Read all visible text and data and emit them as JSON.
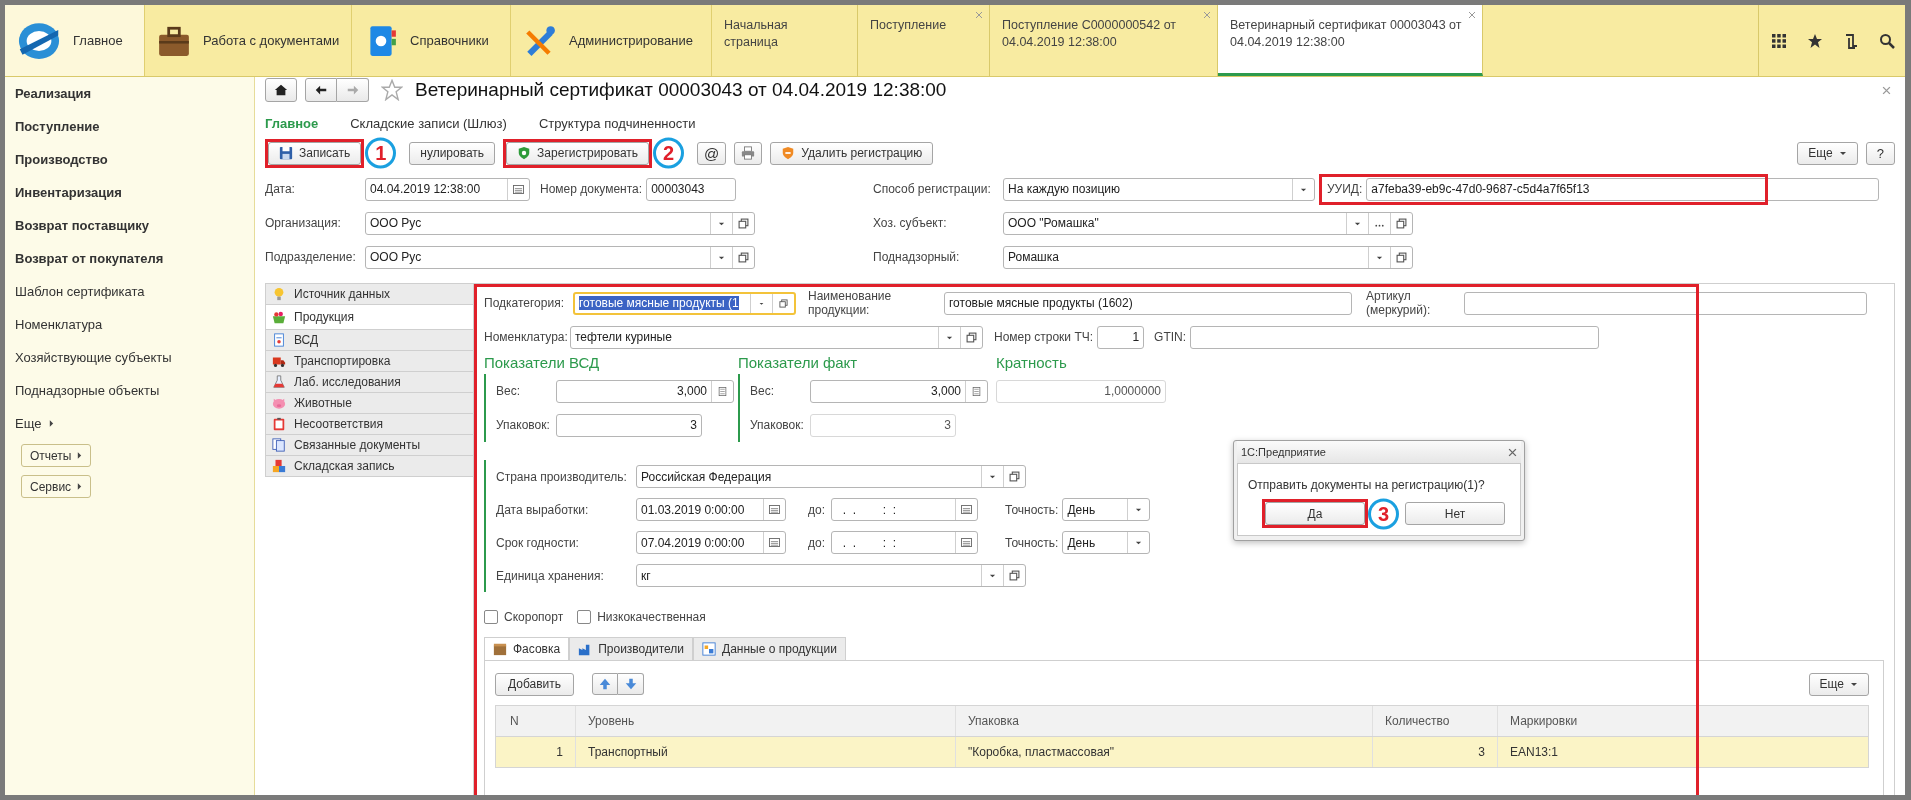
{
  "top_sections": [
    {
      "label": "Главное",
      "kind": "logo",
      "selected": true
    },
    {
      "label": "Работа с документами",
      "kind": "briefcase",
      "selected": false
    },
    {
      "label": "Справочники",
      "kind": "book",
      "selected": false
    },
    {
      "label": "Администрирование",
      "kind": "tools",
      "selected": false
    }
  ],
  "open_tabs": [
    {
      "label": "Начальная страница",
      "closable": false,
      "selected": false
    },
    {
      "label": "Поступление",
      "closable": true,
      "selected": false
    },
    {
      "label": "Поступление С0000000542 от 04.04.2019 12:38:00",
      "closable": true,
      "selected": false
    },
    {
      "label": "Ветеринарный сертификат 00003043 от 04.04.2019 12:38:00",
      "closable": true,
      "selected": true
    }
  ],
  "sidebar": {
    "items": [
      {
        "label": "Реализация",
        "kind": "section"
      },
      {
        "label": "Поступление",
        "kind": "section"
      },
      {
        "label": "Производство",
        "kind": "section"
      },
      {
        "label": "Инвентаризация",
        "kind": "section"
      },
      {
        "label": "Возврат поставщику",
        "kind": "section"
      },
      {
        "label": "Возврат от покупателя",
        "kind": "section"
      },
      {
        "label": "Шаблон сертификата",
        "kind": "link"
      },
      {
        "label": "Номенклатура",
        "kind": "link"
      },
      {
        "label": "Хозяйствующие субъекты",
        "kind": "link"
      },
      {
        "label": "Поднадзорные объекты",
        "kind": "link"
      },
      {
        "label": "Еще",
        "kind": "more"
      }
    ],
    "buttons": [
      "Отчеты",
      "Сервис"
    ]
  },
  "document": {
    "title": "Ветеринарный сертификат 00003043 от 04.04.2019 12:38:00",
    "favorite": false,
    "subtabs": [
      {
        "label": "Главное",
        "selected": true
      },
      {
        "label": "Складские записи (Шлюз)",
        "selected": false
      },
      {
        "label": "Структура подчиненности",
        "selected": false
      }
    ],
    "toolbar": [
      {
        "kind": "save",
        "label": "Записать",
        "highlighted": true,
        "callout": "1"
      },
      {
        "kind": "plain",
        "label": "нулировать",
        "highlighted": false
      },
      {
        "kind": "register",
        "label": "Зарегистрировать",
        "highlighted": true,
        "callout": "2"
      },
      {
        "kind": "glyph",
        "label": "@",
        "highlighted": false
      },
      {
        "kind": "print",
        "highlighted": false
      },
      {
        "kind": "unregister",
        "label": "Удалить регистрацию",
        "highlighted": false
      }
    ],
    "more_button": "Еще",
    "help_button": "?",
    "header": {
      "date": {
        "label": "Дата:",
        "value": "04.04.2019 12:38:00"
      },
      "doc_number": {
        "label": "Номер документа:",
        "value": "00003043"
      },
      "reg_method": {
        "label": "Способ регистрации:",
        "value": "На каждую позицию"
      },
      "uuid": {
        "label": "УУИД:",
        "value": "a7feba39-eb9c-47d0-9687-c5d4a7f65f13",
        "highlighted": true
      },
      "organization": {
        "label": "Организация:",
        "value": "ООО Рус"
      },
      "subject": {
        "label": "Хоз. субъект:",
        "value": "ООО \"Ромашка\""
      },
      "division": {
        "label": "Подразделение:",
        "value": "ООО Рус"
      },
      "supervised": {
        "label": "Поднадзорный:",
        "value": "Ромашка"
      }
    },
    "side_tabs": [
      {
        "label": "Источник данных",
        "kind": "bulb",
        "selected": false
      },
      {
        "label": "Продукция",
        "kind": "basket",
        "selected": true
      },
      {
        "label": "ВСД",
        "kind": "doc",
        "selected": false
      },
      {
        "label": "Транспортировка",
        "kind": "truck",
        "selected": false
      },
      {
        "label": "Лаб. исследования",
        "kind": "flask",
        "selected": false
      },
      {
        "label": "Животные",
        "kind": "pig",
        "selected": false
      },
      {
        "label": "Несоответствия",
        "kind": "clipboard",
        "selected": false
      },
      {
        "label": "Связанные документы",
        "kind": "docs",
        "selected": false
      },
      {
        "label": "Складская запись",
        "kind": "boxes",
        "selected": false
      }
    ],
    "product": {
      "highlighted": true,
      "subcategory": {
        "label": "Подкатегория:",
        "value": "готовые мясные продукты (1"
      },
      "name": {
        "label": "Наименование продукции:",
        "value": "готовые мясные продукты (1602)"
      },
      "article": {
        "label": "Артикул (меркурий):"
      },
      "nomenclature": {
        "label": "Номенклатура:",
        "value": "тефтели куриные"
      },
      "row_number": {
        "label": "Номер строки ТЧ:",
        "value": "1"
      },
      "gtin": {
        "label": "GTIN:"
      },
      "groups": [
        {
          "title": "Показатели ВСД",
          "weight": {
            "label": "Вес:",
            "value": "3,000"
          },
          "packs": {
            "label": "Упаковок:",
            "value": "3",
            "disabled": false
          }
        },
        {
          "title": "Показатели факт",
          "weight": {
            "label": "Вес:",
            "value": "3,000"
          },
          "packs": {
            "label": "Упаковок:",
            "value": "3",
            "disabled": true
          }
        }
      ],
      "multiplicity": {
        "title": "Кратность",
        "value": "1,0000000"
      },
      "country": {
        "label": "Страна производитель:",
        "value": "Российская Федерация"
      },
      "dates": [
        {
          "label": "Дата выработки:",
          "value": "01.03.2019  0:00:00",
          "to_label": "до:",
          "to_value": "  .  .        :  :",
          "precision_label": "Точность:",
          "precision": "День"
        },
        {
          "label": "Срок годности:",
          "value": "07.04.2019  0:00:00",
          "to_label": "до:",
          "to_value": "  .  .        :  :",
          "precision_label": "Точность:",
          "precision": "День"
        }
      ],
      "unit": {
        "label": "Единица хранения:",
        "value": "кг"
      },
      "checkboxes": [
        {
          "label": "Скоропорт",
          "checked": false
        },
        {
          "label": "Низкокачественная",
          "checked": false
        }
      ],
      "tabs": [
        {
          "label": "Фасовка",
          "kind": "box",
          "selected": true
        },
        {
          "label": "Производители",
          "kind": "factory",
          "selected": false
        },
        {
          "label": "Данные о продукции",
          "kind": "data",
          "selected": false
        }
      ],
      "table": {
        "add_button": "Добавить",
        "more_button": "Еще",
        "columns": [
          "N",
          "Уровень",
          "Упаковка",
          "Количество",
          "Маркировки"
        ],
        "rows": [
          {
            "cells": [
              "1",
              "Транспортный",
              "\"Коробка, пластмассовая\"",
              "3",
              "EAN13:1"
            ],
            "selected": true
          }
        ]
      }
    }
  },
  "dialog": {
    "title": "1С:Предприятие",
    "message": "Отправить документы на регистрацию(1)?",
    "buttons": [
      {
        "label": "Да",
        "highlighted": true,
        "callout": "3"
      },
      {
        "label": "Нет",
        "highlighted": false
      }
    ]
  }
}
